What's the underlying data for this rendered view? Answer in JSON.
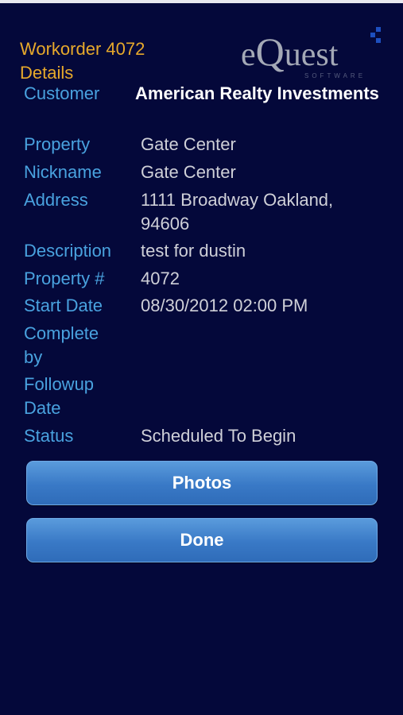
{
  "header": {
    "title": "Workorder 4072 Details",
    "logo": {
      "main_prefix": "e",
      "main_q": "Q",
      "main_suffix": "uest",
      "sub": "SOFTWARE"
    }
  },
  "details": [
    {
      "label": "Customer",
      "value": "American Realty Investments"
    },
    {
      "label": "Property",
      "value": "Gate Center"
    },
    {
      "label": "Nickname",
      "value": "Gate Center"
    },
    {
      "label": "Address",
      "value": "1111 Broadway Oakland, 94606"
    },
    {
      "label": "Description",
      "value": "test for dustin"
    },
    {
      "label": "Property #",
      "value": "4072"
    },
    {
      "label": "Start Date",
      "value": "08/30/2012 02:00 PM"
    },
    {
      "label": "Complete by",
      "value": ""
    },
    {
      "label": "Followup Date",
      "value": ""
    },
    {
      "label": "Status",
      "value": "Scheduled To Begin"
    }
  ],
  "buttons": {
    "photos_label": "Photos",
    "done_label": "Done"
  },
  "colors": {
    "background": "#04083a",
    "title": "#e7a92b",
    "label": "#49a2df",
    "value": "#cfd0d8",
    "button": "#3979c6"
  }
}
